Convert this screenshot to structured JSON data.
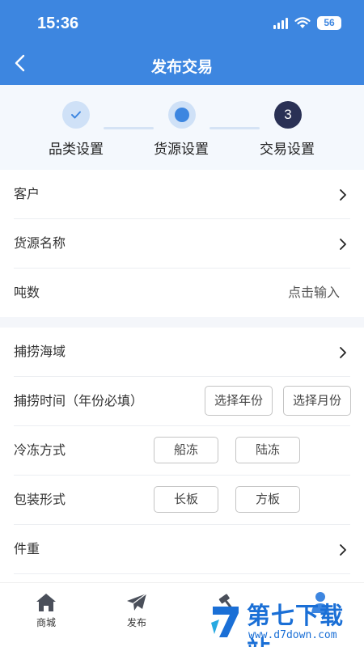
{
  "status_bar": {
    "time": "15:36",
    "battery": "56"
  },
  "header": {
    "title": "发布交易"
  },
  "steps": [
    {
      "label": "品类设置",
      "state": "done"
    },
    {
      "label": "货源设置",
      "state": "current"
    },
    {
      "label": "交易设置",
      "state": "pending",
      "number": "3"
    }
  ],
  "section1": {
    "customer": "客户",
    "goods_name": "货源名称",
    "tonnage": "吨数",
    "tonnage_placeholder": "点击输入"
  },
  "section2": {
    "fishing_area": "捕捞海域",
    "fishing_time": "捕捞时间（年份必填）",
    "select_year": "选择年份",
    "select_month": "选择月份",
    "freeze_method": "冷冻方式",
    "freeze_options": [
      "船冻",
      "陆冻"
    ],
    "packing": "包装形式",
    "packing_options": [
      "长板",
      "方板"
    ],
    "piece_weight": "件重"
  },
  "tabbar": [
    {
      "label": "商城",
      "icon": "home-icon"
    },
    {
      "label": "发布",
      "icon": "send-icon"
    }
  ],
  "watermark": {
    "title": "第七下载站",
    "url": "www.d7down.com"
  },
  "colors": {
    "primary": "#3d86e0",
    "step_active": "#2a3155",
    "watermark": "#1a6fd6"
  }
}
